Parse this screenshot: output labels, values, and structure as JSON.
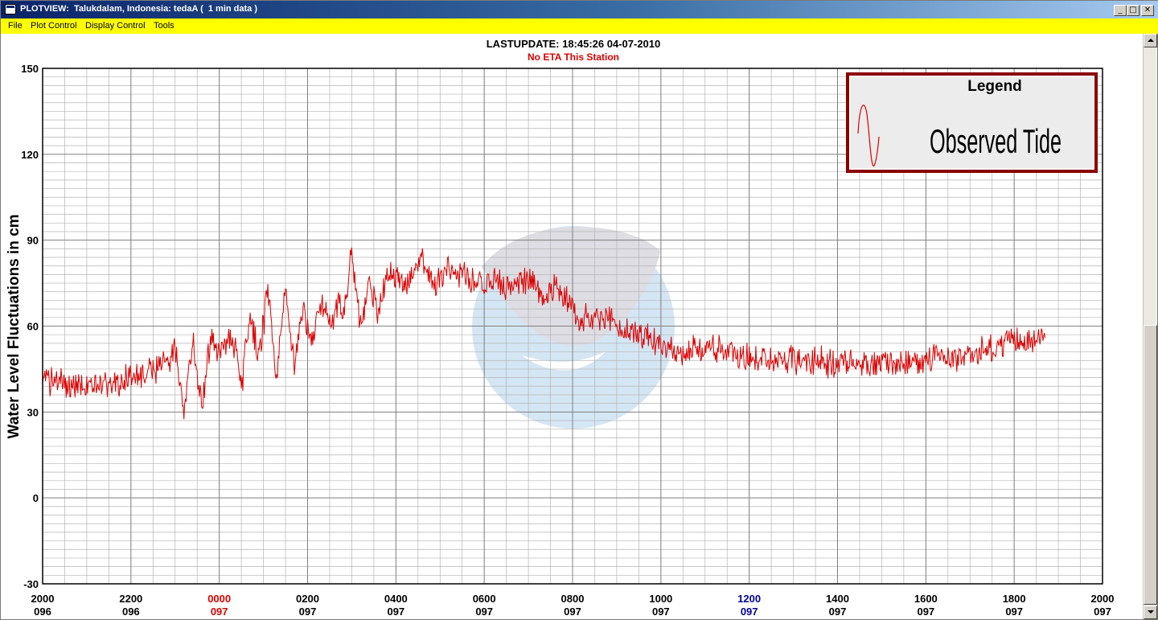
{
  "window": {
    "title": "PLOTVIEW:  Talukdalam, Indonesia: tedaA (  1 min data )",
    "minimize_glyph": "_",
    "maximize_glyph": "□",
    "close_glyph": "✕"
  },
  "menu": {
    "items": [
      "File",
      "Plot Control",
      "Display Control",
      "Tools"
    ]
  },
  "header": {
    "last_update": "LASTUPDATE: 18:45:26  04-07-2010",
    "eta_status": "No ETA This Station"
  },
  "colors": {
    "tide": "#dd0000",
    "eta": "#dd0000",
    "frame": "#000000",
    "legend_border": "#8b0000",
    "watermark": "#b9d7ee",
    "midnight_label": "#dd0000",
    "noon_label": "#000099"
  },
  "chart_data": {
    "type": "line",
    "ylabel": "Water Level Fluctuations in cm",
    "xlabel": "",
    "ylim": [
      -30,
      150
    ],
    "yticks": [
      -30,
      0,
      30,
      60,
      90,
      120,
      150
    ],
    "y_minor_step": 3,
    "x_unit": "hours since 2000 UTC, day 096",
    "xlim": [
      0,
      24
    ],
    "xticks": [
      {
        "x": 0,
        "time": "2000",
        "day": "096",
        "style": "normal"
      },
      {
        "x": 2,
        "time": "2200",
        "day": "096",
        "style": "normal"
      },
      {
        "x": 4,
        "time": "0000",
        "day": "097",
        "style": "midnight"
      },
      {
        "x": 6,
        "time": "0200",
        "day": "097",
        "style": "normal"
      },
      {
        "x": 8,
        "time": "0400",
        "day": "097",
        "style": "normal"
      },
      {
        "x": 10,
        "time": "0600",
        "day": "097",
        "style": "normal"
      },
      {
        "x": 12,
        "time": "0800",
        "day": "097",
        "style": "normal"
      },
      {
        "x": 14,
        "time": "1000",
        "day": "097",
        "style": "normal"
      },
      {
        "x": 16,
        "time": "1200",
        "day": "097",
        "style": "noon"
      },
      {
        "x": 18,
        "time": "1400",
        "day": "097",
        "style": "normal"
      },
      {
        "x": 20,
        "time": "1600",
        "day": "097",
        "style": "normal"
      },
      {
        "x": 22,
        "time": "1800",
        "day": "097",
        "style": "normal"
      },
      {
        "x": 24,
        "time": "2000",
        "day": "097",
        "style": "normal"
      }
    ],
    "grid": true,
    "legend": {
      "title": "Legend",
      "position": "top-right"
    },
    "series": [
      {
        "name": "Observed Tide",
        "color": "#dd0000",
        "noise": 4,
        "x": [
          0,
          0.3,
          0.6,
          1.0,
          1.5,
          2.0,
          2.5,
          2.8,
          3.0,
          3.2,
          3.4,
          3.6,
          3.8,
          4.0,
          4.3,
          4.5,
          4.7,
          4.9,
          5.1,
          5.3,
          5.5,
          5.7,
          5.9,
          6.1,
          6.3,
          6.5,
          6.7,
          6.8,
          7.0,
          7.2,
          7.4,
          7.6,
          7.8,
          8.0,
          8.3,
          8.6,
          8.9,
          9.2,
          9.5,
          9.8,
          10.2,
          10.6,
          11.0,
          11.3,
          11.6,
          11.9,
          12.2,
          12.6,
          13.0,
          13.5,
          14.0,
          14.5,
          15.0,
          15.5,
          16.0,
          17.0,
          18.0,
          19.0,
          20.0,
          20.5,
          21.0,
          21.5,
          22.0,
          22.7
        ],
        "y": [
          43,
          40,
          39,
          40,
          40,
          42,
          44,
          46,
          52,
          30,
          55,
          32,
          56,
          51,
          57,
          38,
          64,
          48,
          72,
          42,
          74,
          46,
          68,
          54,
          67,
          60,
          70,
          64,
          85,
          60,
          76,
          64,
          79,
          76,
          75,
          84,
          74,
          80,
          77,
          76,
          75,
          74,
          77,
          70,
          74,
          68,
          62,
          64,
          60,
          57,
          54,
          50,
          53,
          51,
          48,
          48,
          47,
          47,
          48,
          49,
          50,
          52,
          55,
          55
        ]
      }
    ]
  }
}
